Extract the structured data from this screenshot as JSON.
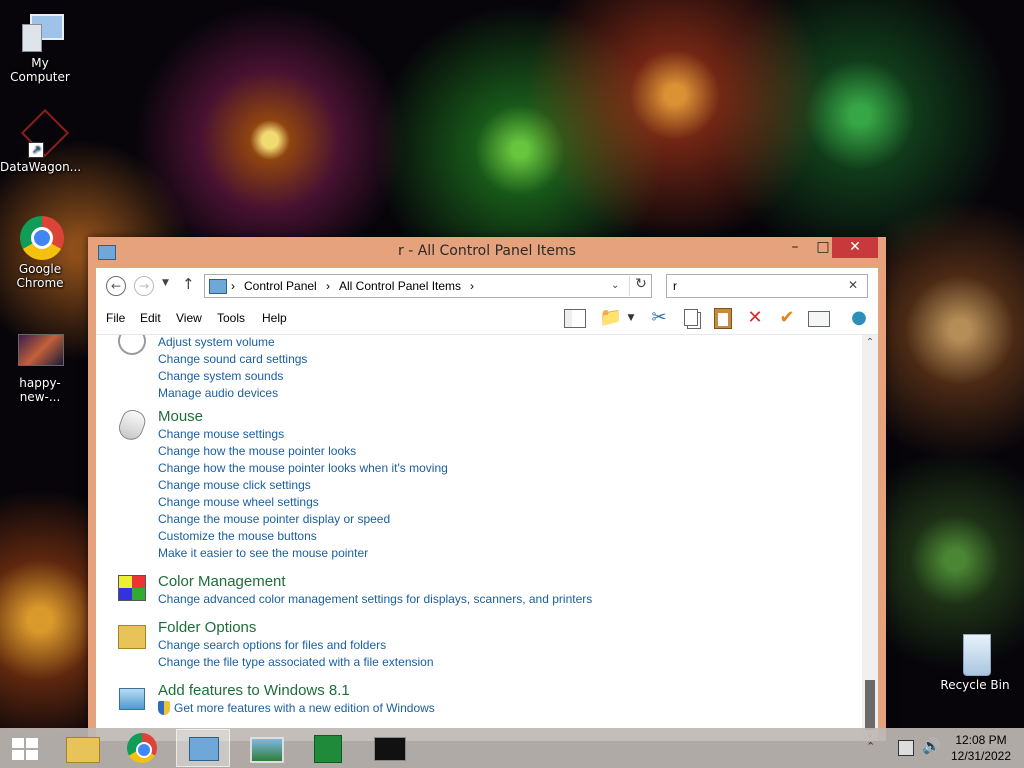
{
  "desktop": {
    "icons": [
      {
        "label": "My Computer",
        "icon": "computer-icon"
      },
      {
        "label": "DataWagon...",
        "icon": "shortcut-icon"
      },
      {
        "label": "Google Chrome",
        "icon": "chrome-icon"
      },
      {
        "label": "happy-new-...",
        "icon": "image-icon"
      },
      {
        "label": "Recycle Bin",
        "icon": "recycle-bin-icon"
      }
    ]
  },
  "window": {
    "title": "r - All Control Panel Items",
    "minimize": "–",
    "maximize": "□",
    "close": "✕"
  },
  "address": {
    "crumbs": [
      "Control Panel",
      "All Control Panel Items"
    ],
    "separator": "›"
  },
  "search": {
    "value": "r",
    "clear": "✕"
  },
  "menu": {
    "items": [
      "File",
      "Edit",
      "View",
      "Tools",
      "Help"
    ]
  },
  "content": {
    "sound_links": [
      "Adjust system volume",
      "Change sound card settings",
      "Change system sounds",
      "Manage audio devices"
    ],
    "mouse": {
      "title": "Mouse",
      "links": [
        "Change mouse settings",
        "Change how the mouse pointer looks",
        "Change how the mouse pointer looks when it's moving",
        "Change mouse click settings",
        "Change mouse wheel settings",
        "Change the mouse pointer display or speed",
        "Customize the mouse buttons",
        "Make it easier to see the mouse pointer"
      ]
    },
    "color": {
      "title": "Color Management",
      "links": [
        "Change advanced color management settings for displays, scanners, and printers"
      ]
    },
    "folder": {
      "title": "Folder Options",
      "links": [
        "Change search options for files and folders",
        "Change the file type associated with a file extension"
      ]
    },
    "features": {
      "title": "Add features to Windows 8.1",
      "links": [
        "Get more features with a new edition of Windows"
      ]
    }
  },
  "taskbar": {
    "time": "12:08 PM",
    "date": "12/31/2022"
  }
}
